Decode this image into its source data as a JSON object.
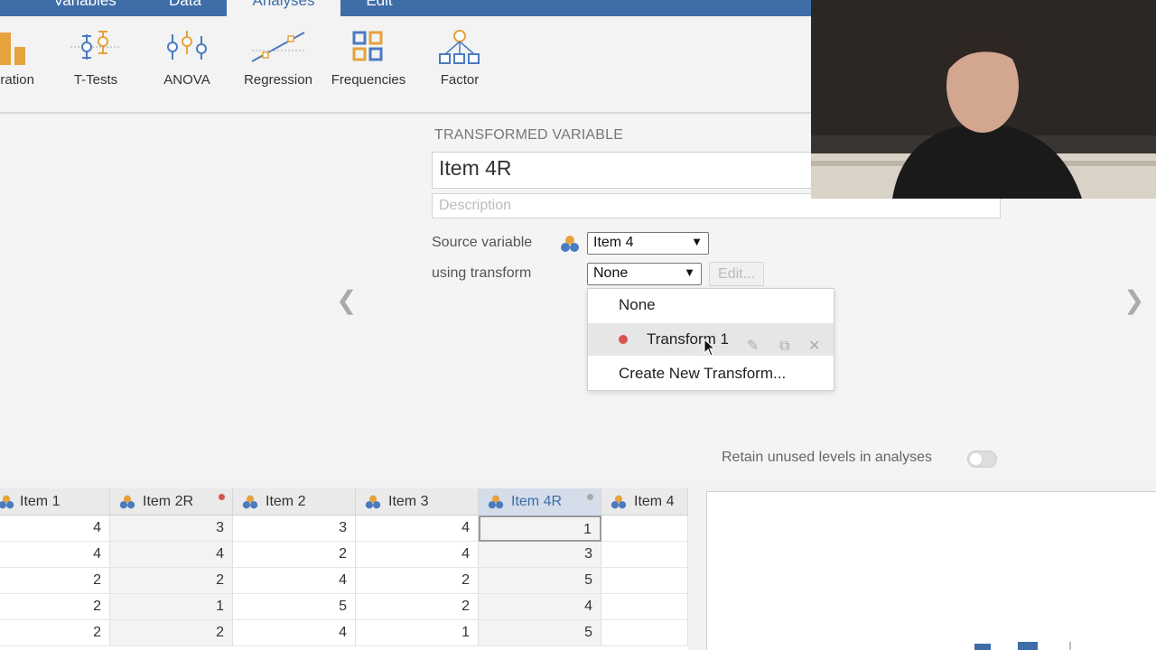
{
  "tabs": [
    "Variables",
    "Data",
    "Analyses",
    "Edit"
  ],
  "active_tab": "Analyses",
  "ribbon": [
    "oration",
    "T-Tests",
    "ANOVA",
    "Regression",
    "Frequencies",
    "Factor"
  ],
  "setup": {
    "section_title": "TRANSFORMED VARIABLE",
    "name_value": "Item 4R",
    "description_placeholder": "Description",
    "source_label": "Source variable",
    "source_value": "Item 4",
    "transform_label": "using transform",
    "transform_value": "None",
    "edit_label": "Edit...",
    "retain_label": "Retain unused levels in analyses",
    "retain_on": false
  },
  "dropdown": {
    "items": [
      "None",
      "Transform 1",
      "Create New Transform..."
    ],
    "hovered_index": 1,
    "transform_color": "#d9534f"
  },
  "grid": {
    "columns": [
      "Item 1",
      "Item 2R",
      "Item 2",
      "Item 3",
      "Item 4R",
      "Item 4"
    ],
    "selected_column": "Item 4R",
    "rows": [
      [
        4,
        3,
        3,
        4,
        1,
        ""
      ],
      [
        4,
        4,
        2,
        4,
        3,
        ""
      ],
      [
        2,
        2,
        4,
        2,
        5,
        ""
      ],
      [
        2,
        1,
        5,
        2,
        4,
        ""
      ],
      [
        2,
        2,
        4,
        1,
        5,
        ""
      ]
    ]
  },
  "colors": {
    "accent": "#3e6da8",
    "orange": "#e6a23c",
    "red_dot": "#d9534f"
  }
}
